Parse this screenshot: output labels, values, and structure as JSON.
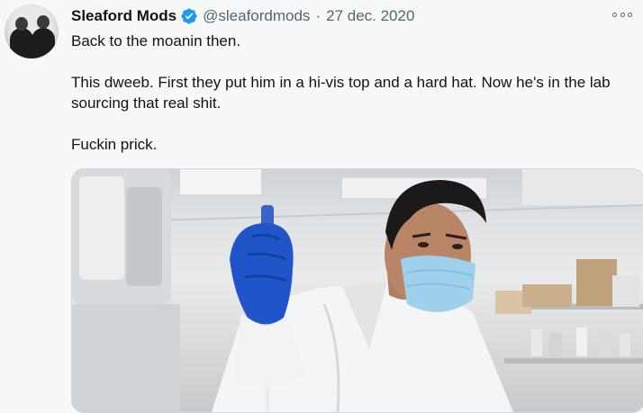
{
  "tweet": {
    "author_name": "Sleaford Mods",
    "handle": "@sleafordmods",
    "separator": "·",
    "date": "27 dec. 2020",
    "text_paragraphs": [
      "Back to the moanin then.",
      "This dweeb. First they put him in a hi-vis top and a hard hat. Now he's in the lab sourcing that real shit.",
      "Fuckin prick."
    ]
  },
  "colors": {
    "verified_badge": "#1d9bf0",
    "glove": "#1f55c8",
    "mask": "#9fd0ec",
    "secondary_text": "#536471"
  },
  "icons": {
    "verified": "verified-badge-icon",
    "more": "more-options-icon"
  }
}
